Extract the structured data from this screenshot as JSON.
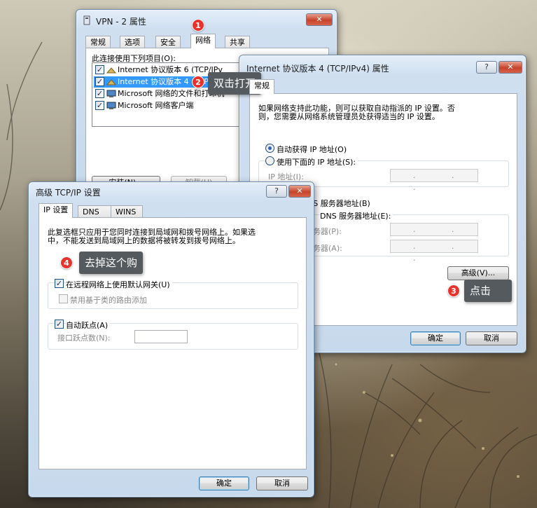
{
  "vpn_window": {
    "title": "VPN - 2 属性",
    "tabs": [
      "常规",
      "选项",
      "安全",
      "网络",
      "共享"
    ],
    "items_label": "此连接使用下列项目(O):",
    "items": [
      "Internet 协议版本 6 (TCP/IPv",
      "Internet 协议版本 4 (TCP/IPv",
      "Microsoft 网络的文件和打印机",
      "Microsoft 网络客户端"
    ],
    "install_button": "安装(N)...",
    "uninstall_button": "卸载(U)",
    "help_btn": "?",
    "close_btn": "✕"
  },
  "ipv4_window": {
    "title": "Internet 协议版本 4 (TCP/IPv4) 属性",
    "tab": "常规",
    "description": "如果网络支持此功能，则可以获取自动指派的 IP 设置。否则，您需要从网络系统管理员处获得适当的 IP 设置。",
    "description_line1": "如果网络支持此功能，则可以获取自动指派的 IP 设置。否",
    "description_line2": "则，您需要从网络系统管理员处获得适当的 IP 设置。",
    "auto_ip": "自动获得 IP 地址(O)",
    "manual_ip": "使用下面的 IP 地址(S):",
    "ip_address_label": "IP 地址(I):",
    "dns_auto": "NS 服务器地址(B)",
    "dns_manual": "DNS 服务器地址(E):",
    "preferred_dns": "务器(P):",
    "alternate_dns": "务器(A):",
    "ip_dots": ". . .",
    "advanced_button": "高级(V)...",
    "ok_button": "确定",
    "cancel_button": "取消",
    "help_btn": "?",
    "close_btn": "✕"
  },
  "adv_window": {
    "title": "高级 TCP/IP 设置",
    "tabs": [
      "IP 设置",
      "DNS",
      "WINS"
    ],
    "description_line1": "此复选框只应用于您同时连接到局域网和拨号网络上。如果选",
    "description_line2": "中，不能发送到局域网上的数据将被转发到拨号网络上。",
    "use_default_gateway": "在远程网络上使用默认网关(U)",
    "disable_class_route": "禁用基于类的路由添加",
    "auto_metric": "自动跃点(A)",
    "interface_metric": "接口跃点数(N):",
    "ok_button": "确定",
    "cancel_button": "取消",
    "help_btn": "?",
    "close_btn": "✕"
  },
  "annotations": [
    {
      "number": "1",
      "text": ""
    },
    {
      "number": "2",
      "text": "双击打开"
    },
    {
      "number": "3",
      "text": "点击"
    },
    {
      "number": "4",
      "text": "去掉这个购"
    }
  ],
  "colors": {
    "callout_bg": "#555a5e",
    "badge_red": "#e8322c",
    "selection": "#3399ff"
  }
}
